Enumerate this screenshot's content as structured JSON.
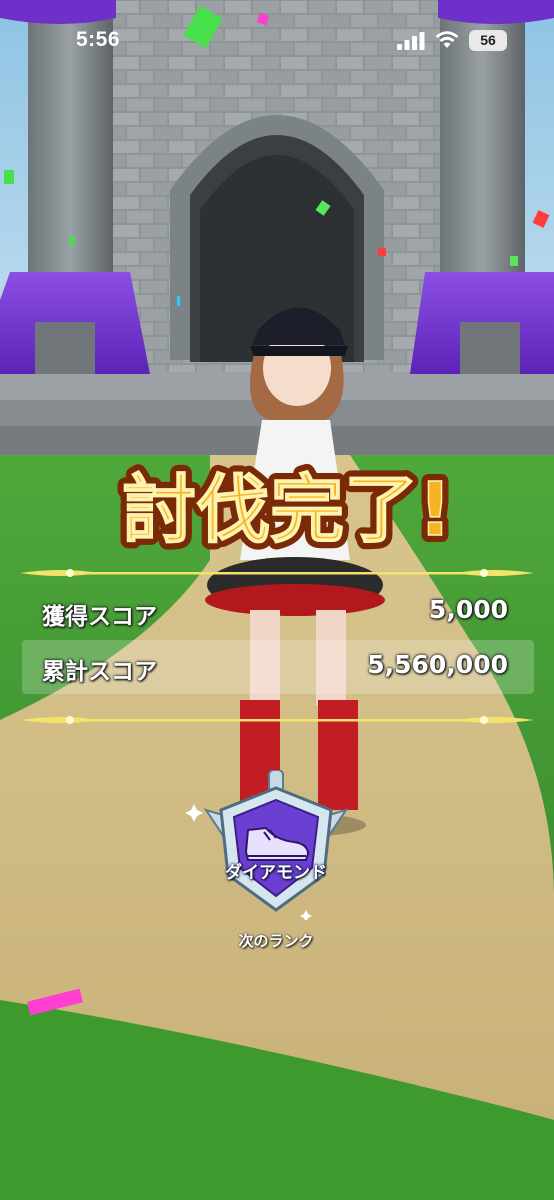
{
  "status_bar": {
    "time": "5:56",
    "battery": "56"
  },
  "result": {
    "title": "討伐完了!",
    "rows": [
      {
        "label": "獲得スコア",
        "value": "5,000"
      },
      {
        "label": "累計スコア",
        "value": "5,560,000"
      }
    ]
  },
  "rank": {
    "name": "ダイアモンド",
    "caption": "次のランク",
    "icon": "sneaker-icon"
  },
  "colors": {
    "title_fill": "#f7b422",
    "title_outline": "#7a2a06",
    "divider_gold": "#f3e36a",
    "badge_purple": "#6b3fd1",
    "badge_silver": "#c7dbe6"
  }
}
